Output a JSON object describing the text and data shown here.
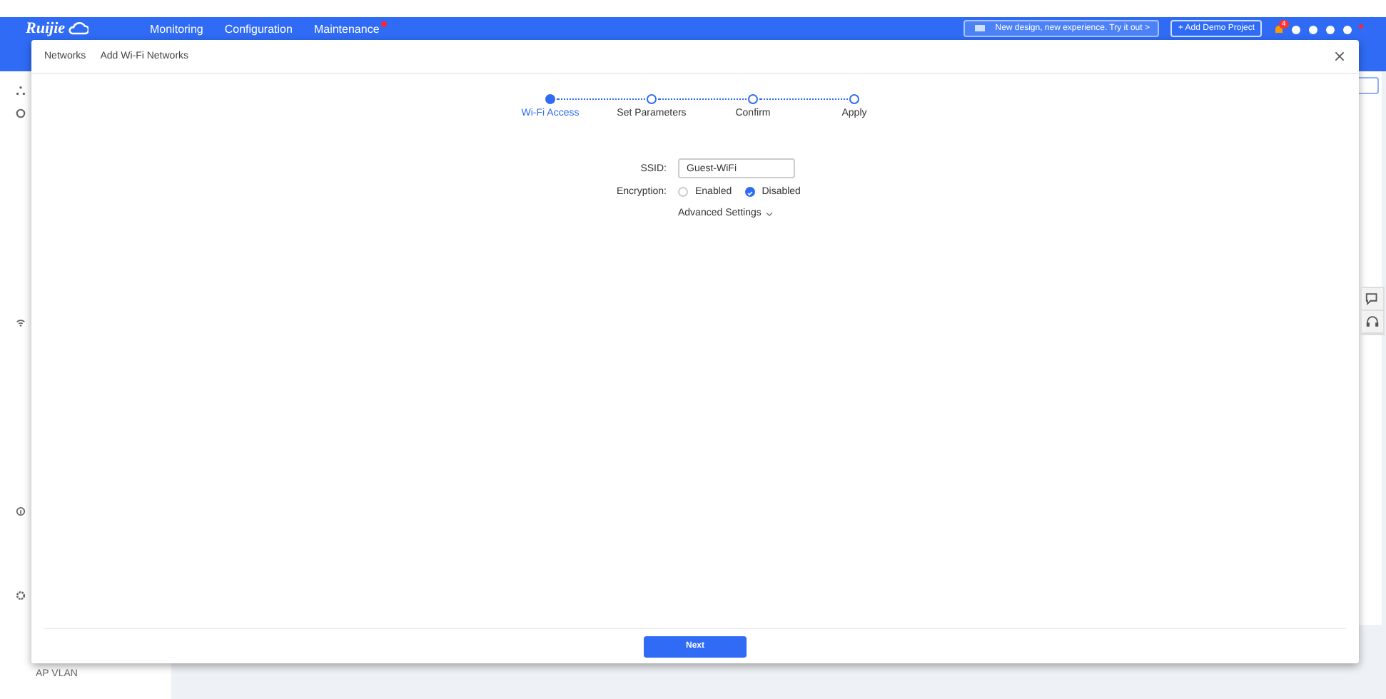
{
  "app": {
    "logo": "Ruijie",
    "nav": [
      {
        "label": "Monitoring",
        "dot": false
      },
      {
        "label": "Configuration",
        "dot": false
      },
      {
        "label": "Maintenance",
        "dot": true
      }
    ],
    "banner": "New design, new experience. Try it out  >",
    "demo_button": "+ Add Demo Project",
    "notification_count": "4",
    "sidebar_label": "AP VLAN"
  },
  "modal": {
    "breadcrumb": [
      "Networks",
      "Add Wi-Fi Networks"
    ],
    "steps": [
      {
        "label": "Wi-Fi Access",
        "selected": true
      },
      {
        "label": "Set Parameters",
        "selected": false
      },
      {
        "label": "Confirm",
        "selected": false
      },
      {
        "label": "Apply",
        "selected": false
      }
    ],
    "ssid": {
      "label": "SSID:",
      "value": "Guest-WiFi"
    },
    "encryption": {
      "label": "Encryption:",
      "options": [
        {
          "label": "Enabled",
          "selected": false
        },
        {
          "label": "Disabled",
          "selected": true
        }
      ]
    },
    "advanced": "Advanced Settings",
    "next": "Next"
  }
}
